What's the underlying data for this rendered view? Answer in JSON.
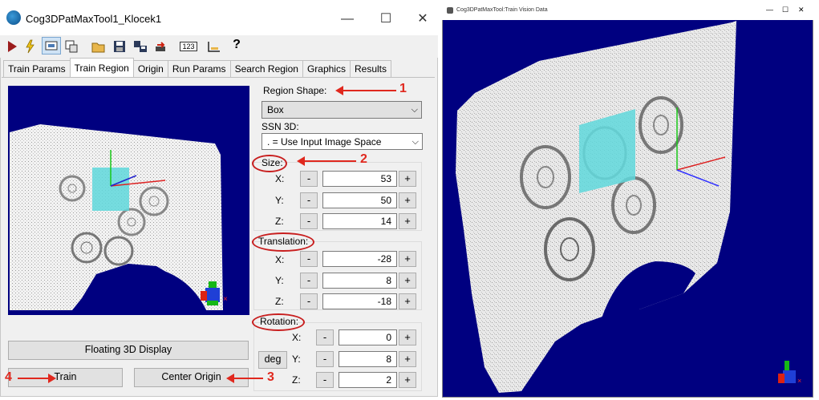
{
  "window": {
    "title": "Cog3DPatMaxTool1_Klocek1",
    "minimize": "—",
    "maximize": "☐",
    "close": "✕"
  },
  "toolbar": {
    "icons": [
      "run-icon",
      "electric-icon",
      "image-icon",
      "display-icon",
      "open-icon",
      "save-icon",
      "save-as-icon",
      "reset-icon",
      "numeric-icon",
      "graph-icon",
      "help-icon"
    ],
    "numeric_label": "123"
  },
  "tabs": [
    {
      "label": "Train Params",
      "active": false
    },
    {
      "label": "Train Region",
      "active": true
    },
    {
      "label": "Origin",
      "active": false
    },
    {
      "label": "Run Params",
      "active": false
    },
    {
      "label": "Search Region",
      "active": false
    },
    {
      "label": "Graphics",
      "active": false
    },
    {
      "label": "Results",
      "active": false
    }
  ],
  "region": {
    "shape_label": "Region Shape:",
    "shape_value": "Box",
    "ssn_label": "SSN 3D:",
    "ssn_value": ". = Use Input Image Space"
  },
  "size": {
    "label": "Size:",
    "x_label": "X:",
    "x": "53",
    "y_label": "Y:",
    "y": "50",
    "z_label": "Z:",
    "z": "14"
  },
  "translation": {
    "label": "Translation:",
    "x_label": "X:",
    "x": "-28",
    "y_label": "Y:",
    "y": "8",
    "z_label": "Z:",
    "z": "-18"
  },
  "rotation": {
    "label": "Rotation:",
    "unit_button": "deg",
    "x_label": "X:",
    "x": "0",
    "y_label": "Y:",
    "y": "8",
    "z_label": "Z:",
    "z": "2"
  },
  "stepper": {
    "minus": "-",
    "plus": "+"
  },
  "buttons": {
    "floating": "Floating 3D Display",
    "train": "Train",
    "center_origin": "Center Origin"
  },
  "annotations": {
    "n1": "1",
    "n2": "2",
    "n3": "3",
    "n4": "4"
  },
  "viewer": {
    "title": "Cog3DPatMaxTool:Train Vision Data",
    "minimize": "—",
    "maximize": "☐",
    "close": "✕"
  },
  "colors": {
    "background_3d": "#000080",
    "train_box": "#5fd8dc",
    "annotation_red": "#e0281e"
  }
}
